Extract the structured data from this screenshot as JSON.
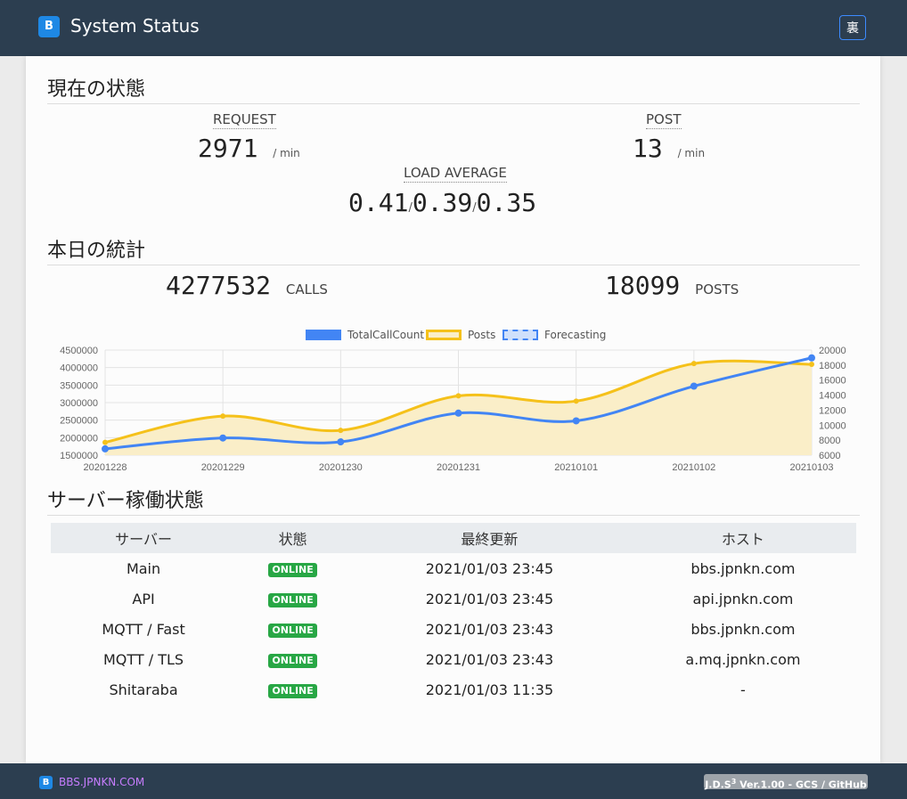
{
  "header": {
    "logo_letter": "B",
    "title": "System Status",
    "theme_button": "裏"
  },
  "current": {
    "title": "現在の状態",
    "request": {
      "label": "REQUEST",
      "value": "2971",
      "unit": "/ min"
    },
    "post": {
      "label": "POST",
      "value": "13",
      "unit": "/ min"
    },
    "load": {
      "label": "LOAD AVERAGE",
      "v1": "0.41",
      "v2": "0.39",
      "v3": "0.35",
      "sep": "/"
    }
  },
  "today": {
    "title": "本日の統計",
    "calls": {
      "value": "4277532",
      "unit": "CALLS"
    },
    "posts": {
      "value": "18099",
      "unit": "POSTS"
    }
  },
  "chart_data": {
    "type": "line",
    "x": [
      "20201228",
      "20201229",
      "20201230",
      "20201231",
      "20210101",
      "20210102",
      "20210103"
    ],
    "series": [
      {
        "name": "TotalCallCount",
        "axis": "left",
        "color": "#4285f4",
        "values": [
          1680000,
          1990000,
          1880000,
          2700000,
          2480000,
          3470000,
          4277532
        ]
      },
      {
        "name": "Posts",
        "axis": "right",
        "color": "#f5c11a",
        "fill": "#faeec8",
        "values": [
          7700,
          11200,
          9300,
          13900,
          13200,
          18200,
          18099
        ]
      },
      {
        "name": "Forecasting",
        "color": "#4285f4",
        "fill": "#cfe0fb",
        "dashed": true,
        "values": []
      }
    ],
    "left_axis": {
      "ylim": [
        1500000,
        4500000
      ],
      "ticks": [
        "4500000",
        "4000000",
        "3500000",
        "3000000",
        "2500000",
        "2000000",
        "1500000"
      ]
    },
    "right_axis": {
      "ylim": [
        6000,
        20000
      ],
      "ticks": [
        "20000",
        "18000",
        "16000",
        "14000",
        "12000",
        "10000",
        "8000",
        "6000"
      ]
    },
    "legend": "top",
    "grid": true
  },
  "servers": {
    "title": "サーバー稼働状態",
    "headers": [
      "サーバー",
      "状態",
      "最終更新",
      "ホスト"
    ],
    "rows": [
      {
        "name": "Main",
        "status": "ONLINE",
        "updated": "2021/01/03 23:45",
        "host": "bbs.jpnkn.com"
      },
      {
        "name": "API",
        "status": "ONLINE",
        "updated": "2021/01/03 23:45",
        "host": "api.jpnkn.com"
      },
      {
        "name": "MQTT / Fast",
        "status": "ONLINE",
        "updated": "2021/01/03 23:43",
        "host": "bbs.jpnkn.com"
      },
      {
        "name": "MQTT / TLS",
        "status": "ONLINE",
        "updated": "2021/01/03 23:43",
        "host": "a.mq.jpnkn.com"
      },
      {
        "name": "Shitaraba",
        "status": "ONLINE",
        "updated": "2021/01/03 11:35",
        "host": "-"
      }
    ]
  },
  "footer": {
    "logo_letter": "B",
    "site": "BBS.JPNKN.COM",
    "version_prefix": "J.D.S",
    "version_sup": "3",
    "version_suffix": " Ver.1.00 - GCS / GitHub"
  }
}
